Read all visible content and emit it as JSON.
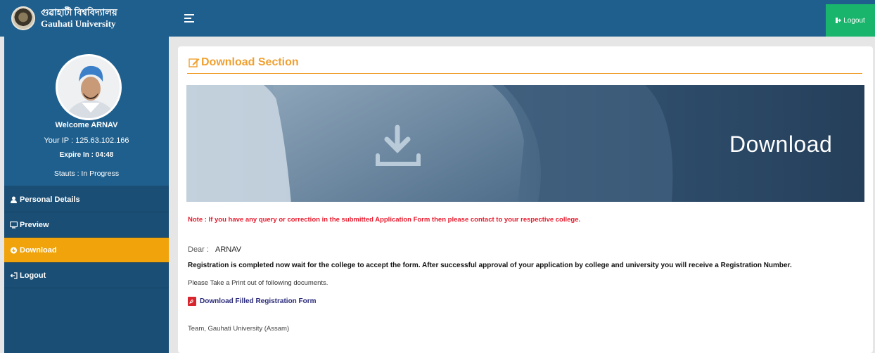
{
  "header": {
    "brand_line1": "গুৱাহাটী বিশ্ববিদ্যালয়",
    "brand_line2": "Gauhati University",
    "logout_label": "Logout"
  },
  "sidebar": {
    "welcome": "Welcome ARNAV",
    "ip_label": "Your IP : 125.63.102.166",
    "expire_label": "Expire In : 04:48",
    "status_label": "Stauts : In Progress",
    "items": [
      {
        "label": "Personal Details",
        "icon": "user-icon"
      },
      {
        "label": "Preview",
        "icon": "monitor-icon"
      },
      {
        "label": "Download",
        "icon": "cloud-download-icon",
        "active": true
      },
      {
        "label": "Logout",
        "icon": "sign-out-icon"
      }
    ]
  },
  "main": {
    "section_title": "Download Section",
    "banner_text": "Download",
    "note": "Note : If you have any query or correction in the submitted Application Form then please contact to your respective college.",
    "dear_label": "Dear :",
    "dear_name": "ARNAV",
    "registration_message": "Registration is completed now wait for the college to accept the form. After successful approval of your application by college and university you will receive a Registration Number.",
    "print_instruction": "Please Take a Print out of following documents.",
    "download_link": "Download Filled Registration Form",
    "signature": "Team, Gauhati University (Assam)"
  },
  "colors": {
    "header_blue": "#1f5f8d",
    "sidebar_dark": "#1a4e74",
    "active_orange": "#f0a30a",
    "logout_green": "#19b56c",
    "title_orange": "#f0a030",
    "note_red": "#e8192c"
  }
}
